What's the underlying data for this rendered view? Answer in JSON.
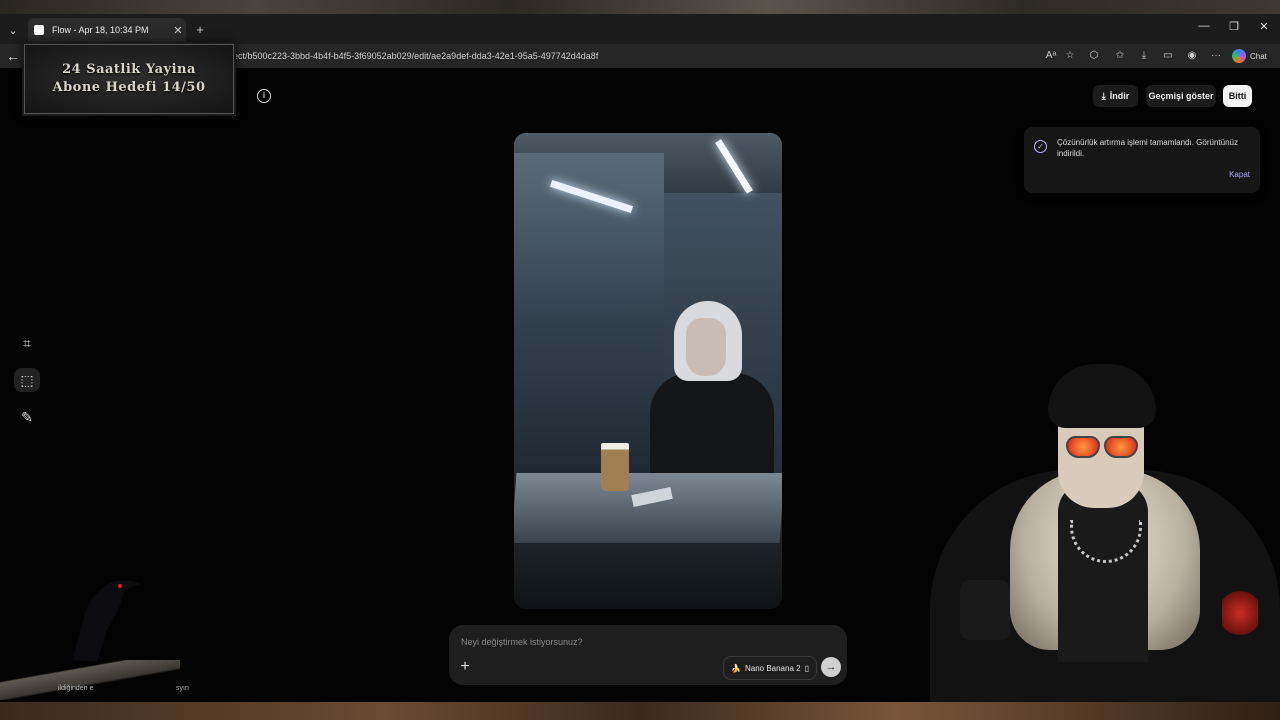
{
  "browser": {
    "tab_title": "Flow - Apr 18, 10:34 PM",
    "url": "oject/b500c223-3bbd-4b4f-b4f5-3f69052ab029/edit/ae2a9def-dda3-42e1-95a5-497742d4da8f",
    "chat_label": "Chat"
  },
  "overlay": {
    "badge_line1": "24 Saatlik Yayina",
    "badge_line2": "Abone Hedefi 14/50"
  },
  "header": {
    "download_label": "İndir",
    "history_label": "Geçmişi göster",
    "done_label": "Bitti"
  },
  "toast": {
    "message": "Çözünürlük artırma işlemi tamamlandı. Görüntünüz indirildi.",
    "close_label": "Kapat"
  },
  "prompt": {
    "placeholder": "Neyi değiştirmek istiyorsunuz?",
    "model_label": "Nano Banana 2"
  },
  "footer": {
    "text_left": "ildiğinden e",
    "text_right": "syın"
  }
}
